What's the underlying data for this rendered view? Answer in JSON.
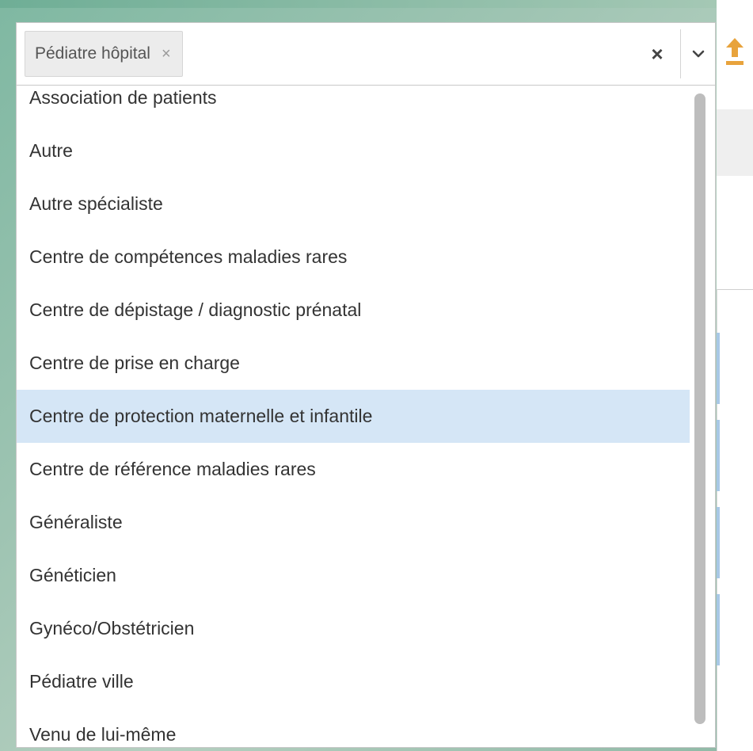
{
  "select": {
    "selected_tag": "Pédiatre hôpital",
    "tag_remove_glyph": "×",
    "clear_glyph": "×"
  },
  "dropdown": {
    "highlighted_index": 6,
    "options": [
      "Association de patients",
      "Autre",
      "Autre spécialiste",
      "Centre de compétences maladies rares",
      "Centre de dépistage / diagnostic prénatal",
      "Centre de prise en charge",
      "Centre de protection maternelle et infantile",
      "Centre de référence maladies rares",
      "Généraliste",
      "Généticien",
      "Gynéco/Obstétricien",
      "Pédiatre ville",
      "Venu de lui-même"
    ]
  },
  "icons": {
    "tag_remove": "close-icon",
    "clear": "close-icon",
    "dropdown": "chevron-down-icon",
    "upload": "upload-icon"
  },
  "colors": {
    "highlight": "#d5e6f6",
    "upload_icon": "#e8a33c",
    "scrollbar": "#bdbdbd"
  }
}
